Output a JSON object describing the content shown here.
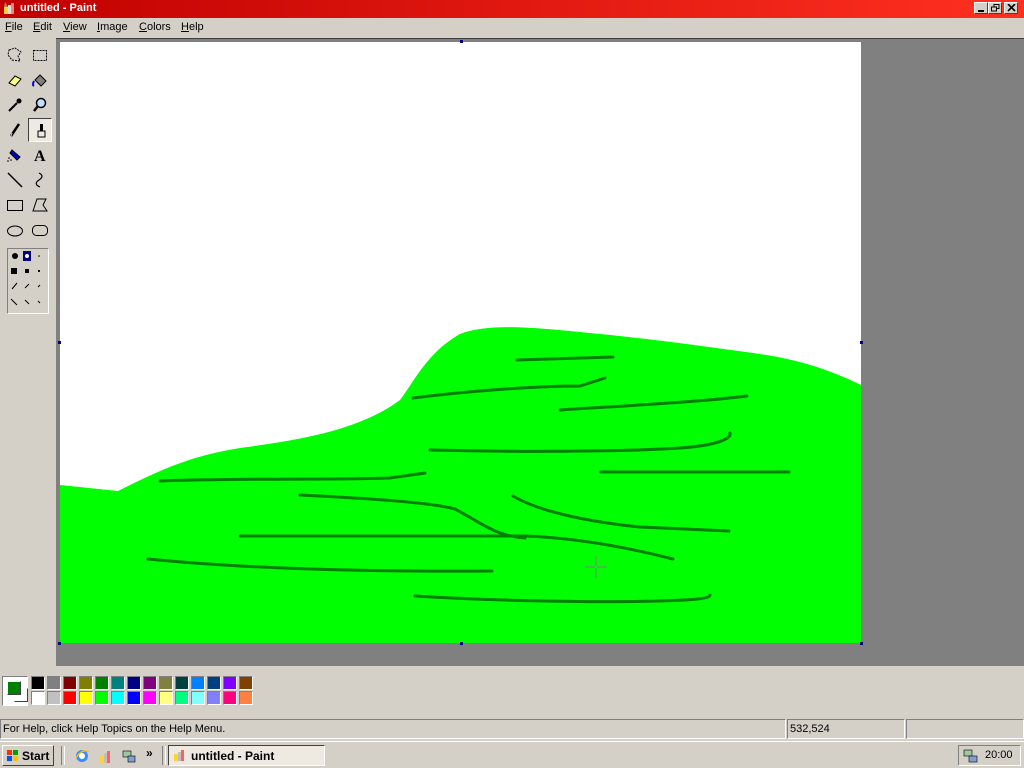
{
  "window": {
    "title": "untitled - Paint",
    "icon": "paint-icon",
    "controls": [
      "minimize-icon",
      "restore-icon",
      "close-icon"
    ]
  },
  "menu": [
    {
      "id": "file",
      "label": "File",
      "accel": "F",
      "rest": "ile"
    },
    {
      "id": "edit",
      "label": "Edit",
      "accel": "E",
      "rest": "dit"
    },
    {
      "id": "view",
      "label": "View",
      "accel": "V",
      "rest": "iew"
    },
    {
      "id": "image",
      "label": "Image",
      "accel": "I",
      "rest": "mage"
    },
    {
      "id": "colors",
      "label": "Colors",
      "accel": "C",
      "rest": "olors"
    },
    {
      "id": "help",
      "label": "Help",
      "accel": "H",
      "rest": "elp"
    }
  ],
  "tools": [
    {
      "id": "free-form-select",
      "icon": "free-form-select-icon"
    },
    {
      "id": "select",
      "icon": "select-icon"
    },
    {
      "id": "eraser",
      "icon": "eraser-icon"
    },
    {
      "id": "fill",
      "icon": "fill-bucket-icon"
    },
    {
      "id": "pick-color",
      "icon": "eyedropper-icon"
    },
    {
      "id": "magnifier",
      "icon": "magnifier-icon"
    },
    {
      "id": "pencil",
      "icon": "pencil-icon"
    },
    {
      "id": "brush",
      "icon": "brush-icon",
      "selected": true
    },
    {
      "id": "airbrush",
      "icon": "airbrush-icon"
    },
    {
      "id": "text",
      "icon": "text-icon",
      "glyph": "A"
    },
    {
      "id": "line",
      "icon": "line-icon"
    },
    {
      "id": "curve",
      "icon": "curve-icon"
    },
    {
      "id": "rectangle",
      "icon": "rectangle-icon"
    },
    {
      "id": "polygon",
      "icon": "polygon-icon"
    },
    {
      "id": "ellipse",
      "icon": "ellipse-icon"
    },
    {
      "id": "rounded-rectangle",
      "icon": "rounded-rectangle-icon"
    }
  ],
  "brush_options": {
    "selected_index": 1,
    "count": 12
  },
  "colors": {
    "foreground": "#008000",
    "background": "#ffffff",
    "canvas_fill": "#00ff00",
    "stroke": "#008000",
    "palette_top": [
      "#000000",
      "#808080",
      "#800000",
      "#808000",
      "#008000",
      "#008080",
      "#000080",
      "#800080",
      "#808040",
      "#004040",
      "#0080ff",
      "#004080",
      "#8000ff",
      "#804000"
    ],
    "palette_bottom": [
      "#ffffff",
      "#c0c0c0",
      "#ff0000",
      "#ffff00",
      "#00ff00",
      "#00ffff",
      "#0000ff",
      "#ff00ff",
      "#ffff80",
      "#00ff80",
      "#80ffff",
      "#8080ff",
      "#ff0080",
      "#ff8040"
    ]
  },
  "status": {
    "help_text": "For Help, click Help Topics on the Help Menu.",
    "coords": "532,524",
    "size": ""
  },
  "taskbar": {
    "start_label": "Start",
    "quick_launch": [
      "internet-explorer-icon",
      "paint-quick-icon",
      "network-icon"
    ],
    "more": "»",
    "task_label": "untitled - Paint",
    "tray_icon": "network-tray-icon",
    "clock": "20:00"
  }
}
